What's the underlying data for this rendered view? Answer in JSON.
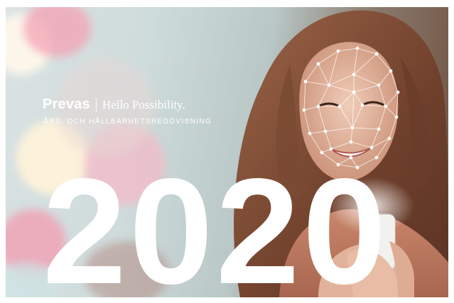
{
  "cover": {
    "brand": {
      "name": "Prevas",
      "tagline": "Hello Possibility."
    },
    "subtitle": "ÅRS- OCH HÅLLBARHETSREDOVISNING",
    "year": "2020"
  },
  "colors": {
    "text": "#ffffff",
    "background_page": "#ffffff",
    "bokeh_pink": "#f3a7b8",
    "bokeh_cream": "#fff5df",
    "hair_brown": "#7a4a33"
  }
}
